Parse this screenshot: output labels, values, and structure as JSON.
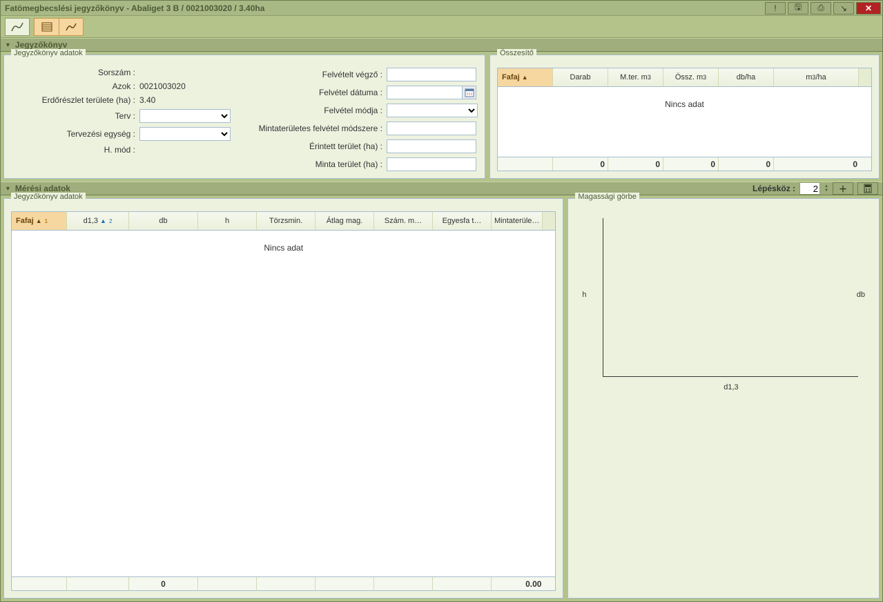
{
  "title": "Fatömegbecslési jegyzőkönyv - Abaliget 3 B / 0021003020 / 3.40ha",
  "toolbar": {},
  "sections": {
    "jegyzokonyv": "Jegyzőkönyv",
    "meresi": "Mérési adatok"
  },
  "form": {
    "labels": {
      "sorszam": "Sorszám :",
      "azok": "Azok :",
      "erdo_terulet": "Erdőrészlet területe (ha) :",
      "terv": "Terv :",
      "terv_egyseg": "Tervezési egység :",
      "hmod": "H. mód :",
      "felvetelt_vegzo": "Felvételt végző :",
      "felvetel_datuma": "Felvétel dátuma :",
      "felvetel_modja": "Felvétel módja :",
      "mintateruletes": "Mintaterületes felvétel módszere :",
      "erintett_terulet": "Érintett terület (ha) :",
      "minta_terulet": "Minta terület (ha) :"
    },
    "values": {
      "azok": "0021003020",
      "erdo_terulet": "3.40"
    }
  },
  "osszesito": {
    "legend": "Összesítő",
    "cols": {
      "fafaj": "Fafaj",
      "darab": "Darab",
      "mter": "M.ter. m",
      "ossz": "Össz. m",
      "dbha": "db/ha",
      "m3ha": "m",
      "m3ha_suffix": "/ha"
    },
    "empty": "Nincs adat",
    "foot": {
      "darab": "0",
      "mter": "0",
      "ossz": "0",
      "dbha": "0",
      "m3ha": "0"
    }
  },
  "meresi": {
    "legend": "Jegyzőkönyv adatok",
    "lepeskoz_label": "Lépésköz :",
    "lepeskoz_value": "2",
    "cols": {
      "fafaj": "Fafaj",
      "d13": "d1,3",
      "db": "db",
      "h": "h",
      "torzsmin": "Törzsmin.",
      "atlag_mag": "Átlag mag.",
      "szam_m": "Szám. m…",
      "egyesfa": "Egyesfa t…",
      "mintaterule": "Mintaterüle…"
    },
    "empty": "Nincs adat",
    "foot": {
      "db": "0",
      "minta": "0.00"
    }
  },
  "gorbe": {
    "legend": "Magassági görbe",
    "y_label": "h",
    "y2_label": "db",
    "x_label": "d1,3"
  }
}
